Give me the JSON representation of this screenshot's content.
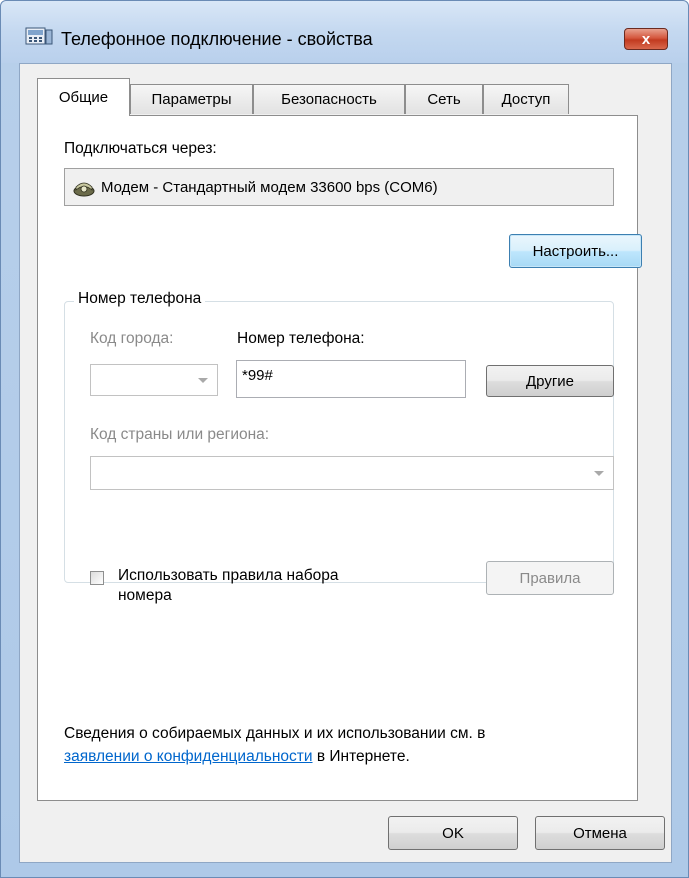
{
  "window": {
    "title": "Телефонное подключение - свойства",
    "close_label": "x"
  },
  "tabs": [
    {
      "label": "Общие",
      "active": true
    },
    {
      "label": "Параметры",
      "active": false
    },
    {
      "label": "Безопасность",
      "active": false
    },
    {
      "label": "Сеть",
      "active": false
    },
    {
      "label": "Доступ",
      "active": false
    }
  ],
  "general": {
    "connect_via_label": "Подключаться через:",
    "device_name": "Модем - Стандартный модем 33600 bps (COM6)",
    "configure_button": "Настроить...",
    "phone_group_title": "Номер телефона",
    "area_code_label": "Код города:",
    "area_code_value": "",
    "phone_number_label": "Номер телефона:",
    "phone_number_value": "*99#",
    "alternates_button": "Другие",
    "country_label": "Код страны или региона:",
    "country_value": "",
    "use_dialing_rules_label_line1": "Использовать правила набора",
    "use_dialing_rules_label_line2": "номера",
    "use_dialing_rules_checked": false,
    "rules_button": "Правила",
    "privacy_text_line1": "Сведения о собираемых данных и их использовании см. в",
    "privacy_link": "заявлении о конфиденциальности",
    "privacy_text_tail": " в Интернете."
  },
  "footer": {
    "ok_button": "OK",
    "cancel_button": "Отмена"
  },
  "colors": {
    "accent_link": "#0066cc",
    "focus_border": "#3c7fb1",
    "close_red": "#c23a20"
  },
  "icons": {
    "title": "phone-connection-icon",
    "device": "modem-icon"
  }
}
